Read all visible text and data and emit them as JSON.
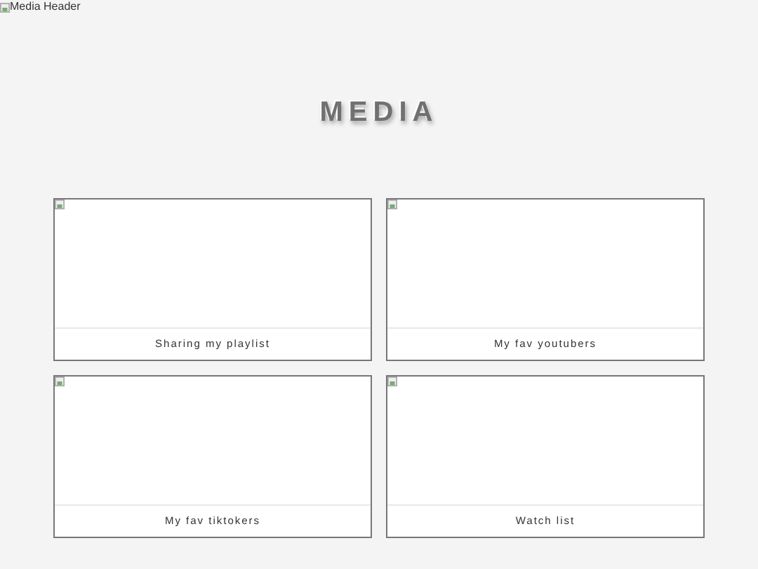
{
  "header_image": {
    "alt": "Media Header"
  },
  "title": "MEDIA",
  "cards": [
    {
      "caption": "Sharing my playlist"
    },
    {
      "caption": "My fav youtubers"
    },
    {
      "caption": "My fav tiktokers"
    },
    {
      "caption": "Watch list"
    }
  ]
}
